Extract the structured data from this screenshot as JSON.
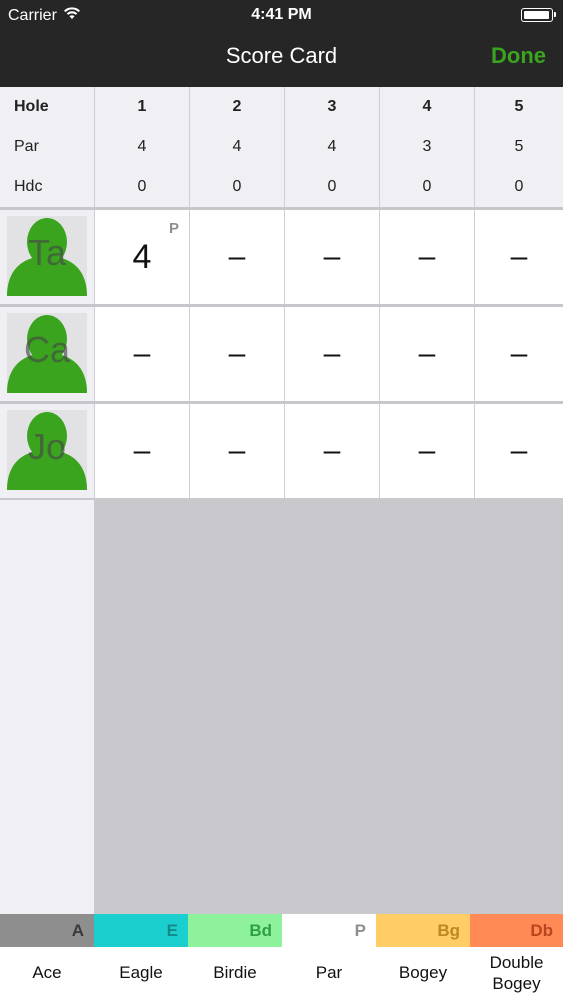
{
  "status": {
    "carrier": "Carrier",
    "time": "4:41 PM",
    "battery_level": 0.95
  },
  "nav": {
    "title": "Score Card",
    "done_label": "Done"
  },
  "header": {
    "hole_label": "Hole",
    "par_label": "Par",
    "hdc_label": "Hdc",
    "holes": [
      {
        "num": "1",
        "par": "4",
        "hdc": "0"
      },
      {
        "num": "2",
        "par": "4",
        "hdc": "0"
      },
      {
        "num": "3",
        "par": "4",
        "hdc": "0"
      },
      {
        "num": "4",
        "par": "3",
        "hdc": "0"
      },
      {
        "num": "5",
        "par": "5",
        "hdc": "0"
      }
    ]
  },
  "players": [
    {
      "initials": "Ta",
      "scores": [
        "4",
        "–",
        "–",
        "–",
        "–"
      ],
      "score_tags": [
        "P",
        "",
        "",
        "",
        ""
      ]
    },
    {
      "initials": "Ca",
      "scores": [
        "–",
        "–",
        "–",
        "–",
        "–"
      ],
      "score_tags": [
        "",
        "",
        "",
        "",
        ""
      ]
    },
    {
      "initials": "Jo",
      "scores": [
        "–",
        "–",
        "–",
        "–",
        "–"
      ],
      "score_tags": [
        "",
        "",
        "",
        "",
        ""
      ]
    }
  ],
  "avatar_color": "#3aa41e",
  "legend": [
    {
      "abbr": "A",
      "label": "Ace",
      "color": "#8e8e8e",
      "text_color": "#3a3a3a"
    },
    {
      "abbr": "E",
      "label": "Eagle",
      "color": "#1ccfcf",
      "text_color": "#138a8a"
    },
    {
      "abbr": "Bd",
      "label": "Birdie",
      "color": "#8ef29d",
      "text_color": "#2ea044"
    },
    {
      "abbr": "P",
      "label": "Par",
      "color": "#ffffff",
      "text_color": "#8e8e93"
    },
    {
      "abbr": "Bg",
      "label": "Bogey",
      "color": "#ffcc66",
      "text_color": "#b88a1f"
    },
    {
      "abbr": "Db",
      "label": "Double Bogey",
      "color": "#ff8a55",
      "text_color": "#b8461f"
    }
  ]
}
